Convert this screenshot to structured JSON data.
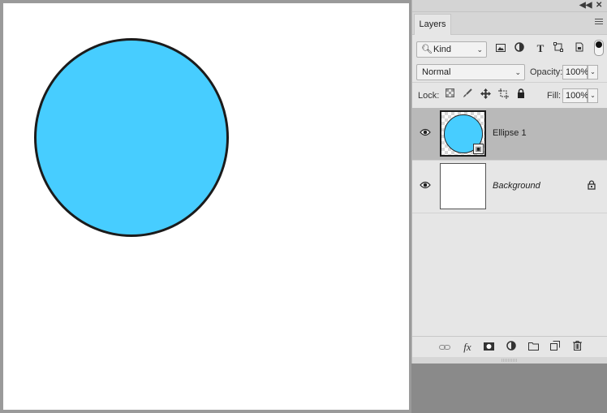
{
  "canvas": {
    "ellipse_fill": "#47cdff",
    "ellipse_stroke": "#1b1b1b"
  },
  "panel": {
    "tab_label": "Layers",
    "topbar_icons": [
      "collapse-icon",
      "close-icon"
    ],
    "filter": {
      "kind_label": "Kind",
      "icons": [
        "image-filter-icon",
        "adjustment-filter-icon",
        "type-filter-icon",
        "shape-filter-icon",
        "smart-object-filter-icon",
        "filter-toggle-icon"
      ]
    },
    "blend_mode": "Normal",
    "opacity_label": "Opacity:",
    "opacity_value": "100%",
    "lock_label": "Lock:",
    "lock_icons": [
      "lock-transparent-icon",
      "lock-image-icon",
      "lock-position-icon",
      "lock-artboard-icon",
      "lock-all-icon"
    ],
    "fill_label": "Fill:",
    "fill_value": "100%",
    "layers": [
      {
        "name": "Ellipse 1",
        "selected": true,
        "visible": true,
        "thumb_fill": "#47cdff"
      },
      {
        "name": "Background",
        "selected": false,
        "visible": true,
        "locked": true
      }
    ],
    "bottom_icons": [
      "link-layers-icon",
      "fx-icon",
      "add-mask-icon",
      "adjustment-layer-icon",
      "new-group-icon",
      "new-layer-icon",
      "delete-layer-icon"
    ]
  }
}
